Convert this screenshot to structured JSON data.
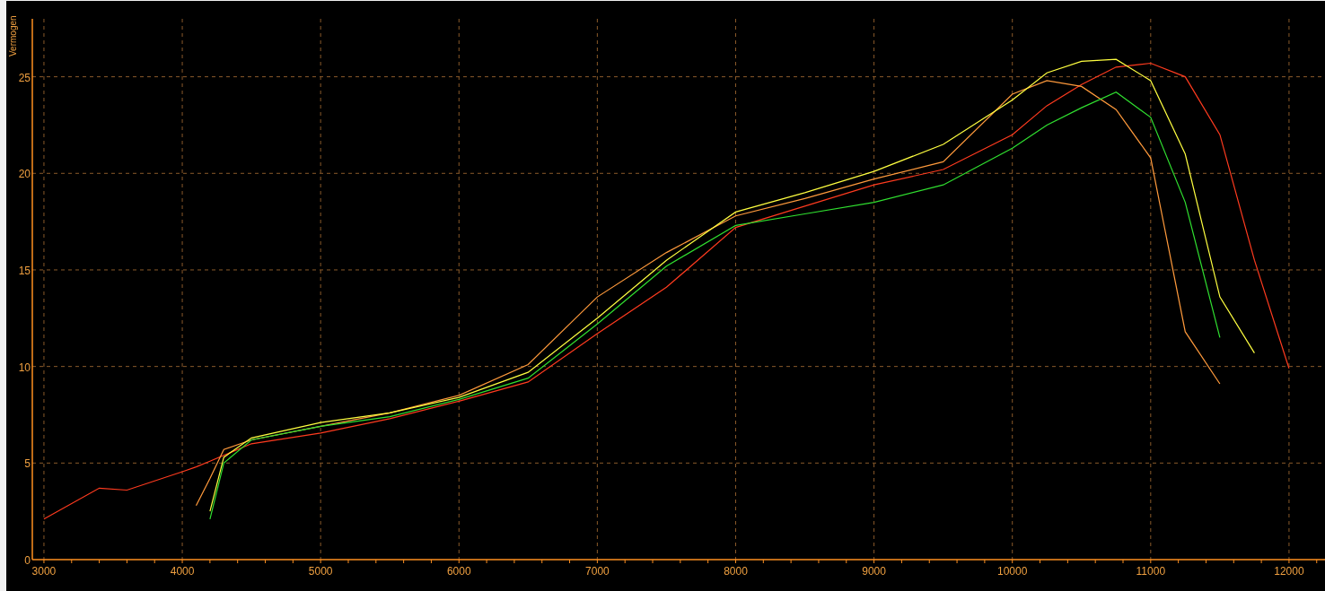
{
  "chart": {
    "chart_data": {
      "type": "line",
      "ylabel": "Vermogen",
      "x": [
        3000,
        3400,
        3600,
        4000,
        4100,
        4200,
        4300,
        4500,
        5000,
        5500,
        6000,
        6500,
        7000,
        7500,
        8000,
        8500,
        9000,
        9500,
        10000,
        10250,
        10500,
        10750,
        11000,
        11250,
        11500,
        11750,
        12000
      ],
      "series": [
        {
          "color": "#ff3b1f",
          "values": [
            2.1,
            3.7,
            3.6,
            4.55,
            4.8,
            5.1,
            5.4,
            6.0,
            6.55,
            7.3,
            8.2,
            9.2,
            11.7,
            14.1,
            17.2,
            18.3,
            19.4,
            20.2,
            22.0,
            23.5,
            24.6,
            25.5,
            25.7,
            25.0,
            22.0,
            15.5,
            9.9
          ]
        },
        {
          "color": "#ff9a3c",
          "values": [
            null,
            null,
            null,
            null,
            2.8,
            4.2,
            5.7,
            6.2,
            6.9,
            7.6,
            8.5,
            10.1,
            13.6,
            15.9,
            17.8,
            18.7,
            19.7,
            20.6,
            24.1,
            24.8,
            24.5,
            23.3,
            20.8,
            11.8,
            9.1,
            null,
            null
          ]
        },
        {
          "color": "#ffff40",
          "values": [
            null,
            null,
            null,
            null,
            null,
            2.5,
            5.3,
            6.3,
            7.1,
            7.6,
            8.4,
            9.7,
            12.5,
            15.5,
            18.0,
            19.0,
            20.1,
            21.5,
            23.8,
            25.2,
            25.8,
            25.9,
            24.8,
            21.0,
            13.6,
            10.7,
            null
          ]
        },
        {
          "color": "#30e030",
          "values": [
            null,
            null,
            null,
            null,
            null,
            2.1,
            5.0,
            6.2,
            6.9,
            7.4,
            8.3,
            9.4,
            12.2,
            15.2,
            17.3,
            17.9,
            18.5,
            19.4,
            21.3,
            22.5,
            23.4,
            24.2,
            22.9,
            18.5,
            11.5,
            null,
            null
          ]
        }
      ],
      "xlim": [
        2916,
        12260
      ],
      "ylim": [
        0,
        28
      ],
      "xticks": [
        3000,
        4000,
        5000,
        6000,
        7000,
        8000,
        9000,
        10000,
        11000,
        12000
      ],
      "yticks": [
        0,
        5,
        10,
        15,
        20,
        25
      ],
      "grid": true
    }
  }
}
